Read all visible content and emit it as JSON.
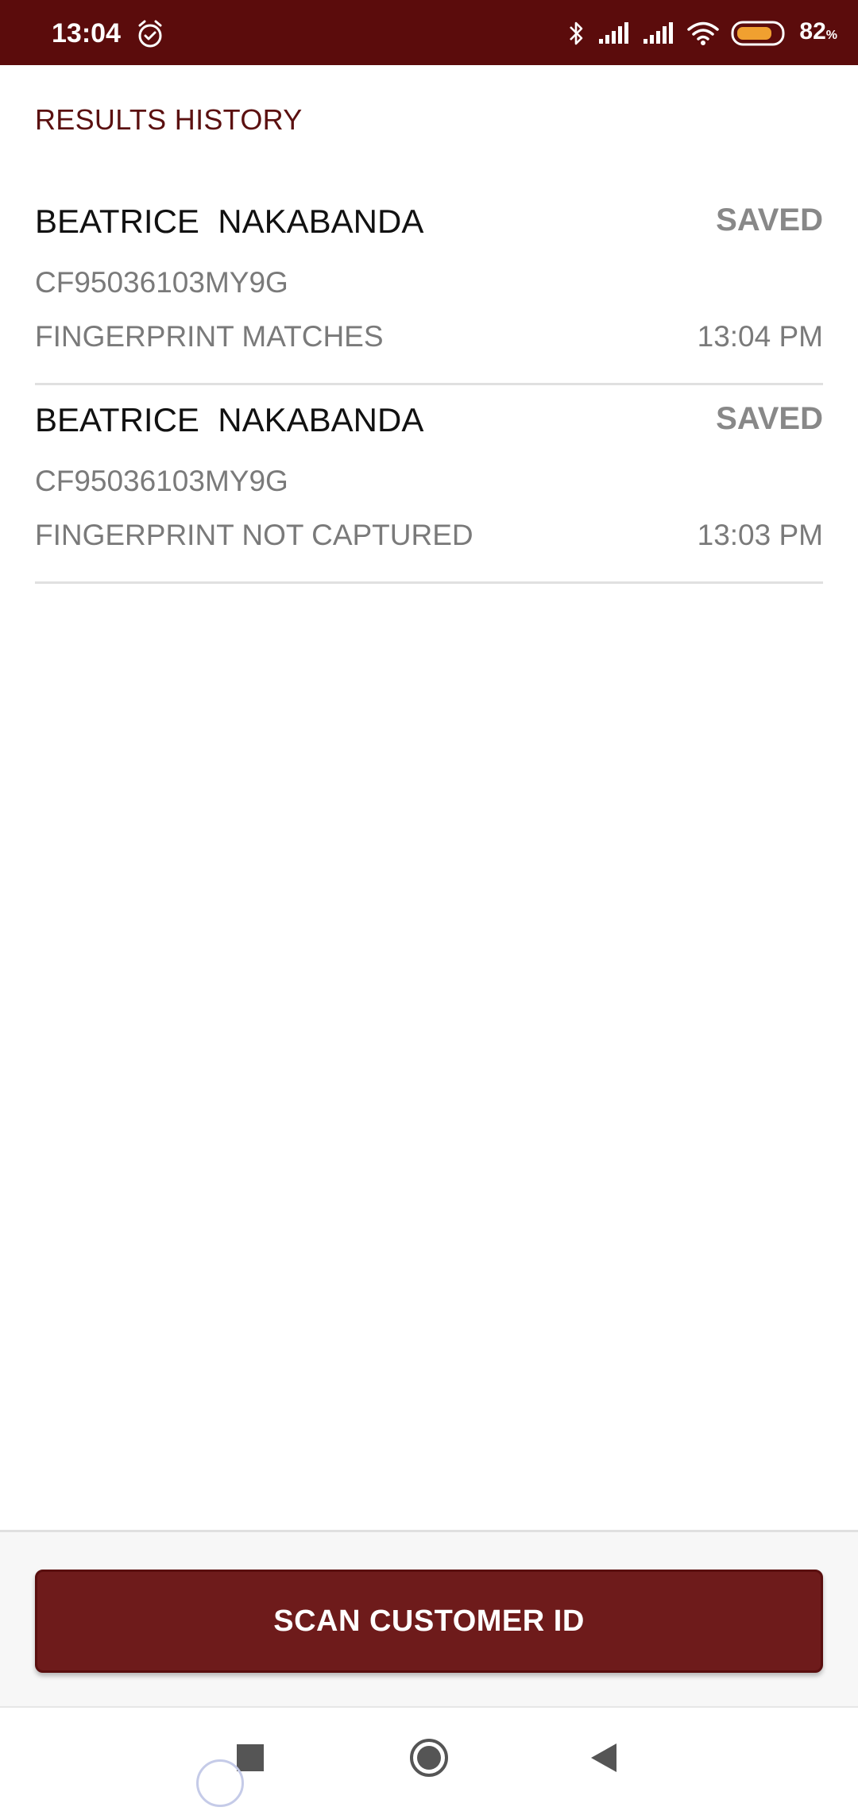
{
  "status_bar": {
    "time": "13:04",
    "battery_percent": "82",
    "battery_unit": "%",
    "icons": [
      "alarm-icon",
      "bluetooth-icon",
      "signal-icon",
      "signal-icon",
      "wifi-icon",
      "battery-icon"
    ],
    "battery_level": 0.82
  },
  "colors": {
    "brand": "#5b0c0c",
    "button": "#6e1b1b",
    "muted_text": "#7a7a7a",
    "battery_fill": "#f0a030"
  },
  "page": {
    "title": "RESULTS HISTORY"
  },
  "history": [
    {
      "name": "BEATRICE  NAKABANDA",
      "status": "SAVED",
      "customer_id": "CF95036103MY9G",
      "result": "FINGERPRINT MATCHES",
      "time": "13:04 PM"
    },
    {
      "name": "BEATRICE  NAKABANDA",
      "status": "SAVED",
      "customer_id": "CF95036103MY9G",
      "result": "FINGERPRINT NOT CAPTURED",
      "time": "13:03 PM"
    }
  ],
  "actions": {
    "scan_label": "SCAN CUSTOMER ID"
  },
  "nav": {
    "icons": [
      "recents-icon",
      "home-icon",
      "back-icon"
    ]
  }
}
